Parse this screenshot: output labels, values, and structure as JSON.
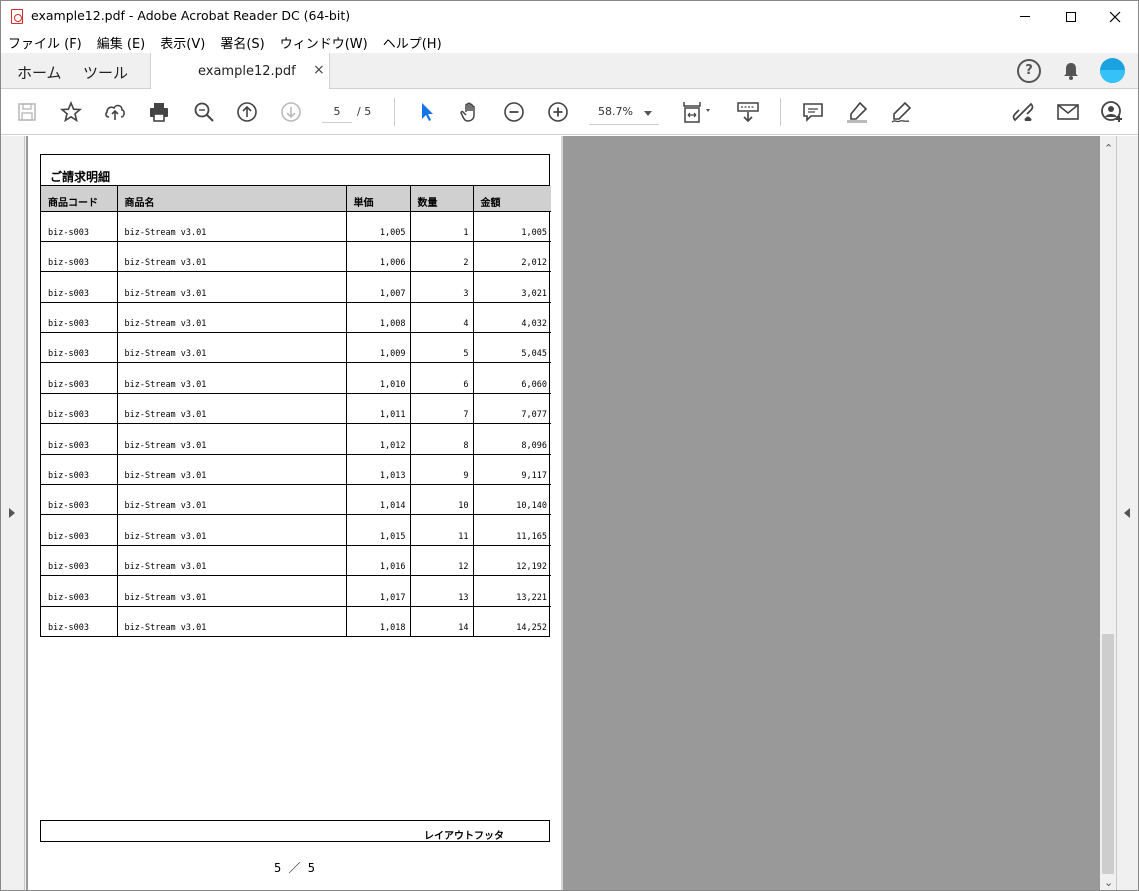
{
  "window": {
    "title": "example12.pdf - Adobe Acrobat Reader DC (64-bit)",
    "minimize": "—",
    "maximize": "☐",
    "close": "✕"
  },
  "menu": [
    "ファイル (F)",
    "編集 (E)",
    "表示(V)",
    "署名(S)",
    "ウィンドウ(W)",
    "ヘルプ(H)"
  ],
  "tabs": {
    "home": "ホーム",
    "tools": "ツール",
    "doc": "example12.pdf",
    "close": "×"
  },
  "header_icons": [
    "help-icon",
    "bell-icon",
    "avatar"
  ],
  "toolbar": {
    "icons": [
      "save-icon",
      "star-icon",
      "upload-icon",
      "print-icon",
      "search-icon",
      "page-up-icon",
      "page-down-icon",
      "pointer-icon",
      "hand-icon",
      "zoom-out-icon",
      "zoom-in-icon",
      "fit-page-icon",
      "scroll-mode-icon",
      "comment-icon",
      "highlight-icon",
      "sign-icon",
      "share-link-icon",
      "mail-icon",
      "add-user-icon"
    ],
    "page_current": "5",
    "page_total": "/ 5",
    "zoom": "58.7%"
  },
  "document": {
    "section_title": "ご請求明細",
    "columns": [
      "商品コード",
      "商品名",
      "単価",
      "数量",
      "金額"
    ],
    "rows": [
      [
        "biz-s003",
        "biz-Stream v3.01",
        "1,005",
        "1",
        "1,005"
      ],
      [
        "biz-s003",
        "biz-Stream v3.01",
        "1,006",
        "2",
        "2,012"
      ],
      [
        "biz-s003",
        "biz-Stream v3.01",
        "1,007",
        "3",
        "3,021"
      ],
      [
        "biz-s003",
        "biz-Stream v3.01",
        "1,008",
        "4",
        "4,032"
      ],
      [
        "biz-s003",
        "biz-Stream v3.01",
        "1,009",
        "5",
        "5,045"
      ],
      [
        "biz-s003",
        "biz-Stream v3.01",
        "1,010",
        "6",
        "6,060"
      ],
      [
        "biz-s003",
        "biz-Stream v3.01",
        "1,011",
        "7",
        "7,077"
      ],
      [
        "biz-s003",
        "biz-Stream v3.01",
        "1,012",
        "8",
        "8,096"
      ],
      [
        "biz-s003",
        "biz-Stream v3.01",
        "1,013",
        "9",
        "9,117"
      ],
      [
        "biz-s003",
        "biz-Stream v3.01",
        "1,014",
        "10",
        "10,140"
      ],
      [
        "biz-s003",
        "biz-Stream v3.01",
        "1,015",
        "11",
        "11,165"
      ],
      [
        "biz-s003",
        "biz-Stream v3.01",
        "1,016",
        "12",
        "12,192"
      ],
      [
        "biz-s003",
        "biz-Stream v3.01",
        "1,017",
        "13",
        "13,221"
      ],
      [
        "biz-s003",
        "biz-Stream v3.01",
        "1,018",
        "14",
        "14,252"
      ]
    ],
    "footer_label": "レイアウトフッタ",
    "page_number": "5 ／ 5"
  }
}
